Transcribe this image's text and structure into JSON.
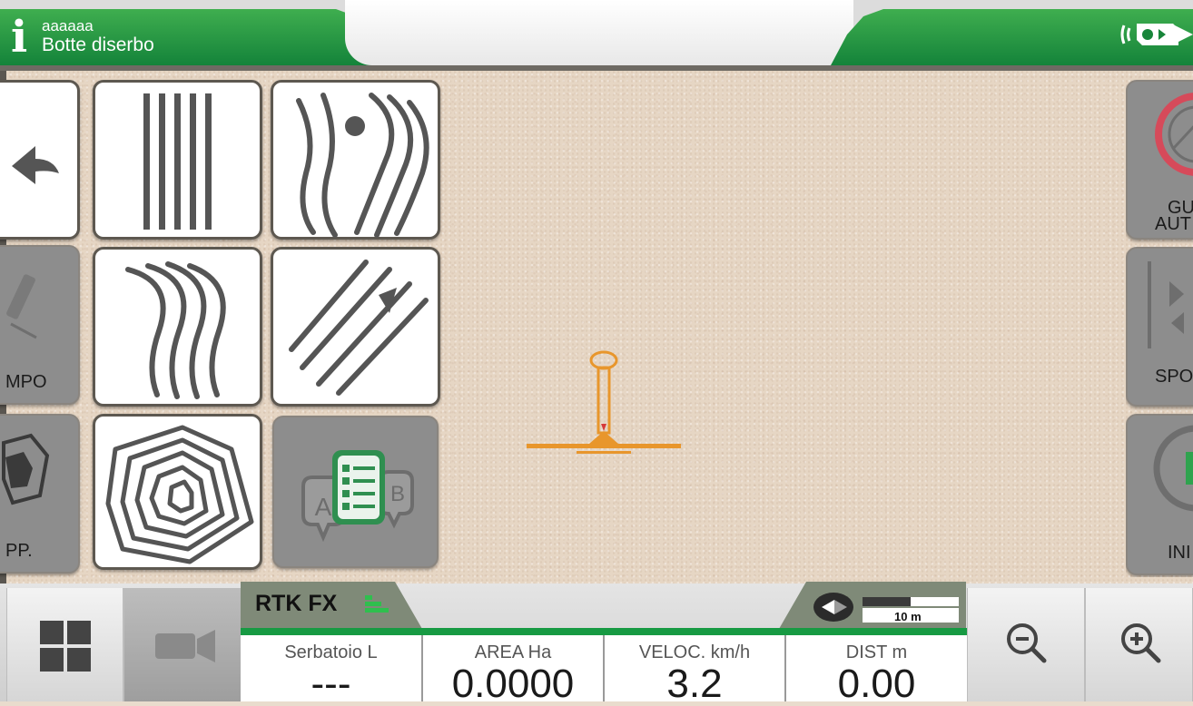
{
  "header": {
    "operator": "aaaaaa",
    "implement": "Botte diserbo",
    "status_icon": "gps-signal-icon"
  },
  "guidance_modes": [
    {
      "name": "back",
      "icon": "back-arrow-icon"
    },
    {
      "name": "straight-lines",
      "icon": "parallel-straight-lines-icon"
    },
    {
      "name": "pivot-curves",
      "icon": "pivot-curves-icon"
    },
    {
      "name": "curved-lines",
      "icon": "curved-lines-icon"
    },
    {
      "name": "ab-lines",
      "icon": "ab-lines-arrow-icon"
    },
    {
      "name": "contour",
      "icon": "contour-lines-icon"
    },
    {
      "name": "ab-selection",
      "icon": "ab-list-icon",
      "enabled": false
    }
  ],
  "left_panel": {
    "campo_label": "MPO",
    "mapp_label": "PP."
  },
  "right_panel": {
    "guida_label_1": "GU",
    "guida_label_2": "AUT",
    "spostamento_label": "SPO",
    "inizio_label": "INI"
  },
  "gnss_status": "RTK FX",
  "scale_label": "10 m",
  "data_fields": [
    {
      "label": "Serbatoio L",
      "value": "---"
    },
    {
      "label": "AREA Ha",
      "value": "0.0000"
    },
    {
      "label": "VELOC. km/h",
      "value": "3.2"
    },
    {
      "label": "DIST m",
      "value": "0.00"
    }
  ],
  "colors": {
    "brand_green": "#179a43",
    "tile_border": "#5d5850",
    "implement_orange": "#e8962c",
    "guide_red": "#d64a5a"
  }
}
